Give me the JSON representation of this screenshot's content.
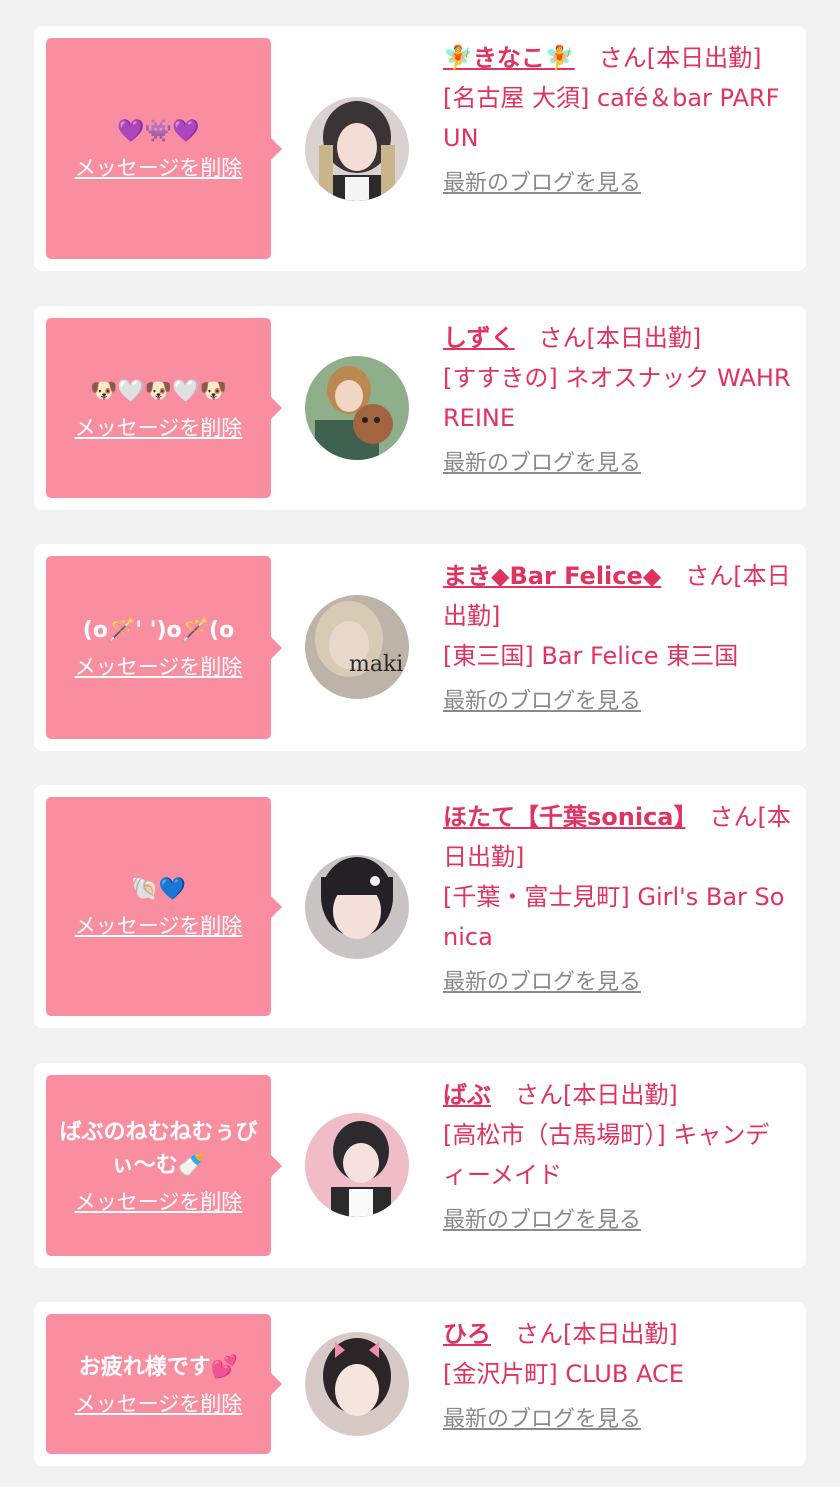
{
  "delete_label": "メッセージを削除",
  "blog_label": "最新のブログを見る",
  "entries": [
    {
      "message": "💜👾💜",
      "name": "🧚きなこ🧚",
      "status": "　さん[本日出勤]",
      "shop": "[名古屋 大須] café＆bar PARFUN"
    },
    {
      "message": "🐶🤍🐶🤍🐶",
      "name": "しずく",
      "status": "　さん[本日出勤]",
      "shop": "[すすきの] ネオスナック WAHR REINE"
    },
    {
      "message": "(o🪄' ')o🪄(o",
      "name": "まき◆Bar Felice◆",
      "status": "　さん[本日出勤]",
      "shop": "[東三国] Bar Felice 東三国",
      "avatar_text": "maki"
    },
    {
      "message": "🐚💙",
      "name": "ほたて【千葉sonica】",
      "status": "　さん[本日出勤]",
      "shop": "[千葉・富士見町] Girl's Bar Sonica"
    },
    {
      "message": "ばぶのねむねむぅびぃ〜む🍼",
      "name": "ばぶ",
      "status": "　さん[本日出勤]",
      "shop": "[高松市（古馬場町）] キャンディーメイド"
    },
    {
      "message": "お疲れ様です💕",
      "name": "ひろ",
      "status": "　さん[本日出勤]",
      "shop": "[金沢片町] CLUB ACE"
    }
  ]
}
